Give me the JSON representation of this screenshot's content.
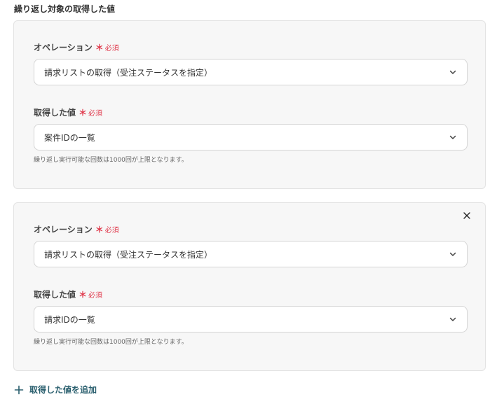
{
  "section_title": "繰り返し対象の取得した値",
  "cards": [
    {
      "operation_label": "オペレーション",
      "required_star": "＊",
      "required_text": "必須",
      "operation_value": "請求リストの取得（受注ステータスを指定）",
      "value_label": "取得した値",
      "value_value": "案件IDの一覧",
      "hint": "繰り返し実行可能な回数は1000回が上限となります。"
    },
    {
      "operation_label": "オペレーション",
      "required_star": "＊",
      "required_text": "必須",
      "operation_value": "請求リストの取得（受注ステータスを指定）",
      "value_label": "取得した値",
      "value_value": "請求IDの一覧",
      "hint": "繰り返し実行可能な回数は1000回が上限となります。"
    }
  ],
  "add_button_label": "取得した値を追加",
  "colors": {
    "required": "#e0384b",
    "accent": "#2a5f6e"
  }
}
